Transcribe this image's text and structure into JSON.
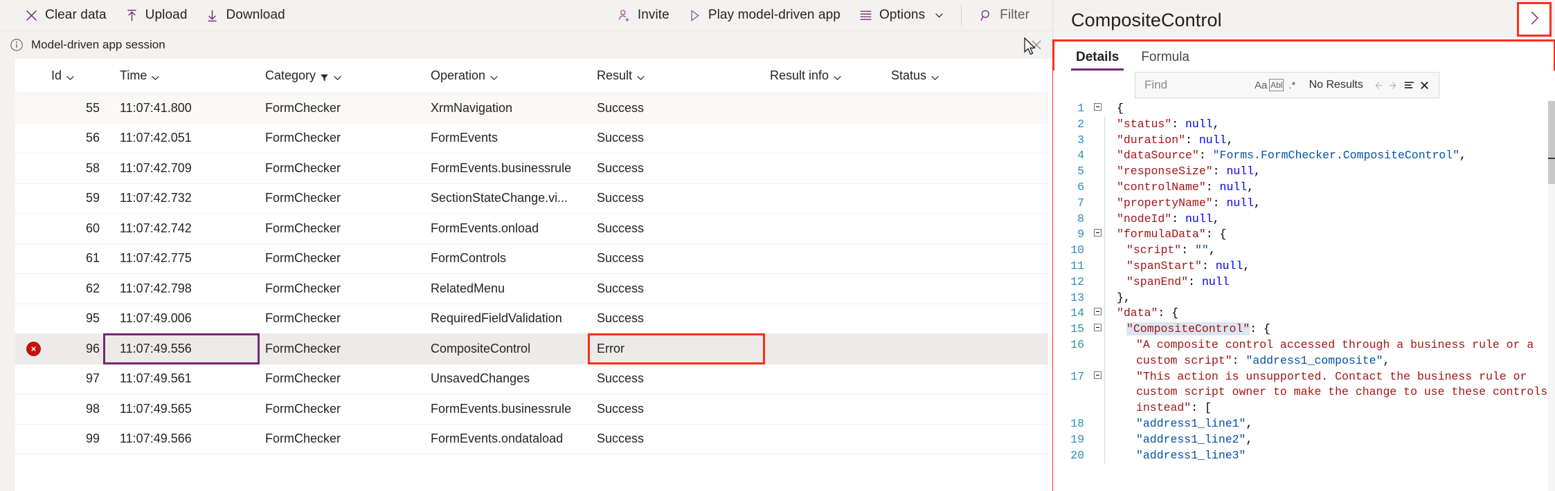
{
  "commandbar": {
    "left_buttons": [
      {
        "label": "Clear data",
        "icon": "close-x-icon"
      },
      {
        "label": "Upload",
        "icon": "upload-arrow-icon"
      },
      {
        "label": "Download",
        "icon": "download-arrow-icon"
      }
    ],
    "right_buttons": [
      {
        "label": "Invite",
        "icon": "person-add-icon"
      },
      {
        "label": "Play model-driven app",
        "icon": "play-triangle-icon"
      },
      {
        "label": "Options",
        "icon": "options-lines-icon",
        "has_chevron": true
      },
      {
        "label": "Filter",
        "icon": "search-magnifier-icon"
      }
    ]
  },
  "session": {
    "label": "Model-driven app session",
    "info_icon": "info-circle-icon",
    "close_icon": "close-x-icon"
  },
  "table": {
    "columns": [
      {
        "key": "id",
        "label": "Id",
        "sortable": true,
        "filtered": false
      },
      {
        "key": "time",
        "label": "Time",
        "sortable": true,
        "filtered": false
      },
      {
        "key": "category",
        "label": "Category",
        "sortable": true,
        "filtered": true
      },
      {
        "key": "operation",
        "label": "Operation",
        "sortable": true,
        "filtered": false
      },
      {
        "key": "result",
        "label": "Result",
        "sortable": true,
        "filtered": false
      },
      {
        "key": "result_info",
        "label": "Result info",
        "sortable": true,
        "filtered": false
      },
      {
        "key": "status",
        "label": "Status",
        "sortable": true,
        "filtered": false
      }
    ],
    "rows": [
      {
        "id": "55",
        "time": "11:07:41.800",
        "category": "FormChecker",
        "operation": "XrmNavigation",
        "result": "Success",
        "result_info": "",
        "status": "",
        "state": "normal"
      },
      {
        "id": "56",
        "time": "11:07:42.051",
        "category": "FormChecker",
        "operation": "FormEvents",
        "result": "Success",
        "result_info": "",
        "status": "",
        "state": "normal"
      },
      {
        "id": "58",
        "time": "11:07:42.709",
        "category": "FormChecker",
        "operation": "FormEvents.businessrule",
        "result": "Success",
        "result_info": "",
        "status": "",
        "state": "normal"
      },
      {
        "id": "59",
        "time": "11:07:42.732",
        "category": "FormChecker",
        "operation": "SectionStateChange.vi...",
        "result": "Success",
        "result_info": "",
        "status": "",
        "state": "normal"
      },
      {
        "id": "60",
        "time": "11:07:42.742",
        "category": "FormChecker",
        "operation": "FormEvents.onload",
        "result": "Success",
        "result_info": "",
        "status": "",
        "state": "normal"
      },
      {
        "id": "61",
        "time": "11:07:42.775",
        "category": "FormChecker",
        "operation": "FormControls",
        "result": "Success",
        "result_info": "",
        "status": "",
        "state": "normal"
      },
      {
        "id": "62",
        "time": "11:07:42.798",
        "category": "FormChecker",
        "operation": "RelatedMenu",
        "result": "Success",
        "result_info": "",
        "status": "",
        "state": "normal"
      },
      {
        "id": "95",
        "time": "11:07:49.006",
        "category": "FormChecker",
        "operation": "RequiredFieldValidation",
        "result": "Success",
        "result_info": "",
        "status": "",
        "state": "normal"
      },
      {
        "id": "96",
        "time": "11:07:49.556",
        "category": "FormChecker",
        "operation": "CompositeControl",
        "result": "Error",
        "result_info": "",
        "status": "",
        "state": "error-selected"
      },
      {
        "id": "97",
        "time": "11:07:49.561",
        "category": "FormChecker",
        "operation": "UnsavedChanges",
        "result": "Success",
        "result_info": "",
        "status": "",
        "state": "normal"
      },
      {
        "id": "98",
        "time": "11:07:49.565",
        "category": "FormChecker",
        "operation": "FormEvents.businessrule",
        "result": "Success",
        "result_info": "",
        "status": "",
        "state": "normal"
      },
      {
        "id": "99",
        "time": "11:07:49.566",
        "category": "FormChecker",
        "operation": "FormEvents.ondataload",
        "result": "Success",
        "result_info": "",
        "status": "",
        "state": "normal"
      }
    ]
  },
  "details_panel": {
    "title": "CompositeControl",
    "expand_icon": "chevron-right-icon",
    "tabs": [
      {
        "label": "Details",
        "active": true
      },
      {
        "label": "Formula",
        "active": false
      }
    ],
    "find": {
      "placeholder": "Find",
      "value": "",
      "match_case_label": "Aa",
      "whole_word_label": "Abl",
      "regex_label": ".*",
      "results_text": "No Results",
      "prev_icon": "arrow-left-icon",
      "next_icon": "arrow-right-icon",
      "filter_icon": "find-in-selection-icon",
      "close_icon": "close-x-icon"
    },
    "json_lines": [
      {
        "num": "1",
        "fold": true,
        "guide": false,
        "indent": 0,
        "tokens": [
          {
            "t": "p",
            "s": "{"
          }
        ]
      },
      {
        "num": "2",
        "fold": false,
        "guide": true,
        "indent": 1,
        "tokens": [
          {
            "t": "k",
            "s": "\"status\""
          },
          {
            "t": "p",
            "s": ": "
          },
          {
            "t": "null",
            "s": "null"
          },
          {
            "t": "p",
            "s": ","
          }
        ]
      },
      {
        "num": "3",
        "fold": false,
        "guide": true,
        "indent": 1,
        "tokens": [
          {
            "t": "k",
            "s": "\"duration\""
          },
          {
            "t": "p",
            "s": ": "
          },
          {
            "t": "null",
            "s": "null"
          },
          {
            "t": "p",
            "s": ","
          }
        ]
      },
      {
        "num": "4",
        "fold": false,
        "guide": true,
        "indent": 1,
        "tokens": [
          {
            "t": "k",
            "s": "\"dataSource\""
          },
          {
            "t": "p",
            "s": ": "
          },
          {
            "t": "str",
            "s": "\"Forms.FormChecker.CompositeControl\""
          },
          {
            "t": "p",
            "s": ","
          }
        ]
      },
      {
        "num": "5",
        "fold": false,
        "guide": true,
        "indent": 1,
        "tokens": [
          {
            "t": "k",
            "s": "\"responseSize\""
          },
          {
            "t": "p",
            "s": ": "
          },
          {
            "t": "null",
            "s": "null"
          },
          {
            "t": "p",
            "s": ","
          }
        ]
      },
      {
        "num": "6",
        "fold": false,
        "guide": true,
        "indent": 1,
        "tokens": [
          {
            "t": "k",
            "s": "\"controlName\""
          },
          {
            "t": "p",
            "s": ": "
          },
          {
            "t": "null",
            "s": "null"
          },
          {
            "t": "p",
            "s": ","
          }
        ]
      },
      {
        "num": "7",
        "fold": false,
        "guide": true,
        "indent": 1,
        "tokens": [
          {
            "t": "k",
            "s": "\"propertyName\""
          },
          {
            "t": "p",
            "s": ": "
          },
          {
            "t": "null",
            "s": "null"
          },
          {
            "t": "p",
            "s": ","
          }
        ]
      },
      {
        "num": "8",
        "fold": false,
        "guide": true,
        "indent": 1,
        "tokens": [
          {
            "t": "k",
            "s": "\"nodeId\""
          },
          {
            "t": "p",
            "s": ": "
          },
          {
            "t": "null",
            "s": "null"
          },
          {
            "t": "p",
            "s": ","
          }
        ]
      },
      {
        "num": "9",
        "fold": true,
        "guide": true,
        "indent": 1,
        "tokens": [
          {
            "t": "k",
            "s": "\"formulaData\""
          },
          {
            "t": "p",
            "s": ": {"
          }
        ]
      },
      {
        "num": "10",
        "fold": false,
        "guide": true,
        "indent": 2,
        "tokens": [
          {
            "t": "k",
            "s": "\"script\""
          },
          {
            "t": "p",
            "s": ": "
          },
          {
            "t": "str",
            "s": "\"\""
          },
          {
            "t": "p",
            "s": ","
          }
        ]
      },
      {
        "num": "11",
        "fold": false,
        "guide": true,
        "indent": 2,
        "tokens": [
          {
            "t": "k",
            "s": "\"spanStart\""
          },
          {
            "t": "p",
            "s": ": "
          },
          {
            "t": "null",
            "s": "null"
          },
          {
            "t": "p",
            "s": ","
          }
        ]
      },
      {
        "num": "12",
        "fold": false,
        "guide": true,
        "indent": 2,
        "tokens": [
          {
            "t": "k",
            "s": "\"spanEnd\""
          },
          {
            "t": "p",
            "s": ": "
          },
          {
            "t": "null",
            "s": "null"
          }
        ]
      },
      {
        "num": "13",
        "fold": false,
        "guide": true,
        "indent": 1,
        "tokens": [
          {
            "t": "p",
            "s": "},"
          }
        ]
      },
      {
        "num": "14",
        "fold": true,
        "guide": true,
        "indent": 1,
        "tokens": [
          {
            "t": "k",
            "s": "\"data\""
          },
          {
            "t": "p",
            "s": ": {"
          }
        ]
      },
      {
        "num": "15",
        "fold": true,
        "guide": true,
        "indent": 2,
        "tokens": [
          {
            "t": "k-hl",
            "s": "\"CompositeControl\""
          },
          {
            "t": "p",
            "s": ": {"
          }
        ]
      },
      {
        "num": "16",
        "fold": false,
        "guide": true,
        "indent": 3,
        "tokens": [
          {
            "t": "k",
            "s": "\"A composite control accessed through a business rule or a custom script\""
          },
          {
            "t": "p",
            "s": ": "
          },
          {
            "t": "str",
            "s": "\"address1_composite\""
          },
          {
            "t": "p",
            "s": ","
          }
        ]
      },
      {
        "num": "17",
        "fold": true,
        "guide": true,
        "indent": 3,
        "tokens": [
          {
            "t": "k",
            "s": "\"This action is unsupported. Contact the business rule or custom script owner to make the change to use these controls instead\""
          },
          {
            "t": "p",
            "s": ": ["
          }
        ]
      },
      {
        "num": "18",
        "fold": false,
        "guide": true,
        "indent": 3,
        "tokens": [
          {
            "t": "str",
            "s": "\"address1_line1\""
          },
          {
            "t": "p",
            "s": ","
          }
        ]
      },
      {
        "num": "19",
        "fold": false,
        "guide": true,
        "indent": 3,
        "tokens": [
          {
            "t": "str",
            "s": "\"address1_line2\""
          },
          {
            "t": "p",
            "s": ","
          }
        ]
      },
      {
        "num": "20",
        "fold": false,
        "guide": true,
        "indent": 3,
        "tokens": [
          {
            "t": "str",
            "s": "\"address1_line3\""
          }
        ]
      }
    ]
  },
  "colors": {
    "accent_purple": "#742774",
    "highlight_red": "#ff2d20",
    "error_red": "#c1120f",
    "chrome_gray": "#f3f2f1",
    "json_key": "#a31515",
    "json_string": "#0451a5",
    "json_null": "#0000ff",
    "line_number": "#2b91af"
  }
}
